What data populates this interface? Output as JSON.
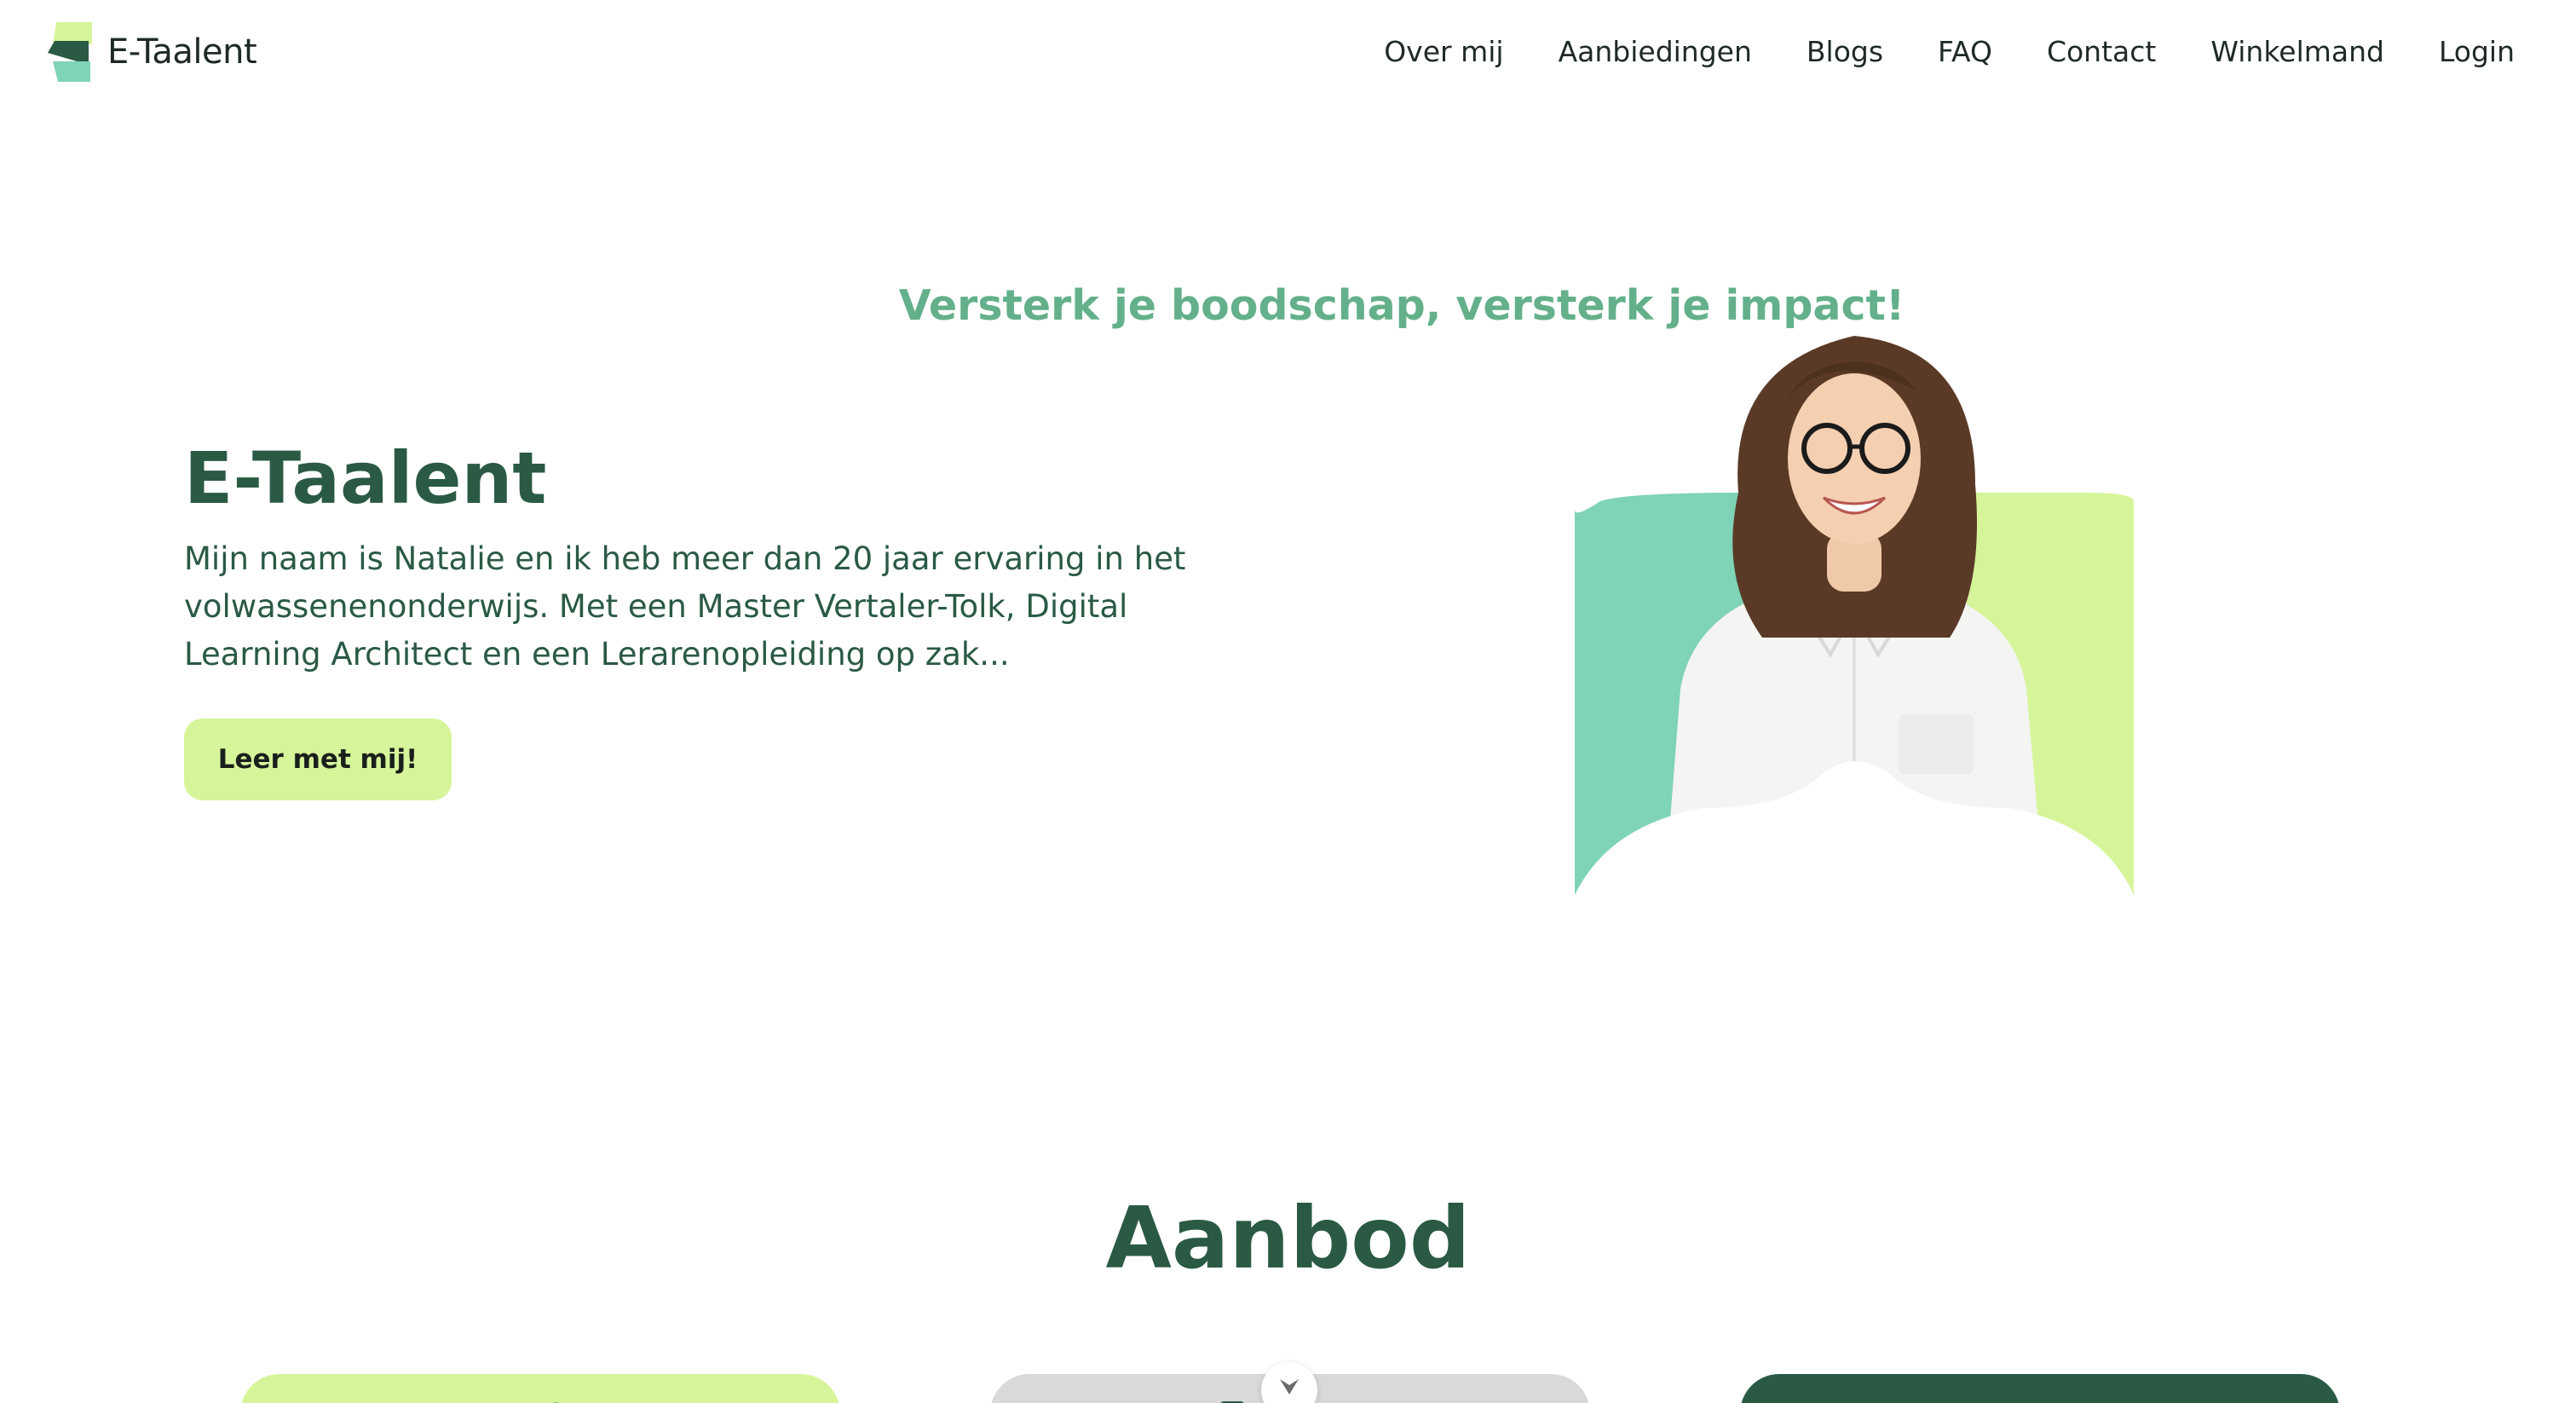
{
  "brand": {
    "name": "E-Taalent"
  },
  "nav": {
    "items": [
      {
        "label": "Over mij"
      },
      {
        "label": "Aanbiedingen"
      },
      {
        "label": "Blogs"
      },
      {
        "label": "FAQ"
      },
      {
        "label": "Contact"
      },
      {
        "label": "Winkelmand"
      },
      {
        "label": "Login"
      }
    ]
  },
  "hero": {
    "tagline": "Versterk je boodschap, versterk je impact!",
    "title": "E-Taalent",
    "text": "Mijn naam is Natalie en ik heb meer dan 20 jaar ervaring in het volwassenenonderwijs. Met een Master Vertaler-Tolk, Digital Learning Architect en een Lerarenopleiding op zak...",
    "cta_label": "Leer met mij!",
    "image_icon": "portrait-photo"
  },
  "offer": {
    "title": "Aanbod"
  },
  "icons": {
    "logo": "e-taalent-logo-icon",
    "scroll": "chevron-down-icon"
  },
  "colors": {
    "primary_dark": "#2a5a44",
    "accent_green": "#63b08a",
    "lime": "#d6f59a",
    "mint": "#7fd3b7",
    "grey": "#d9d9d9"
  }
}
